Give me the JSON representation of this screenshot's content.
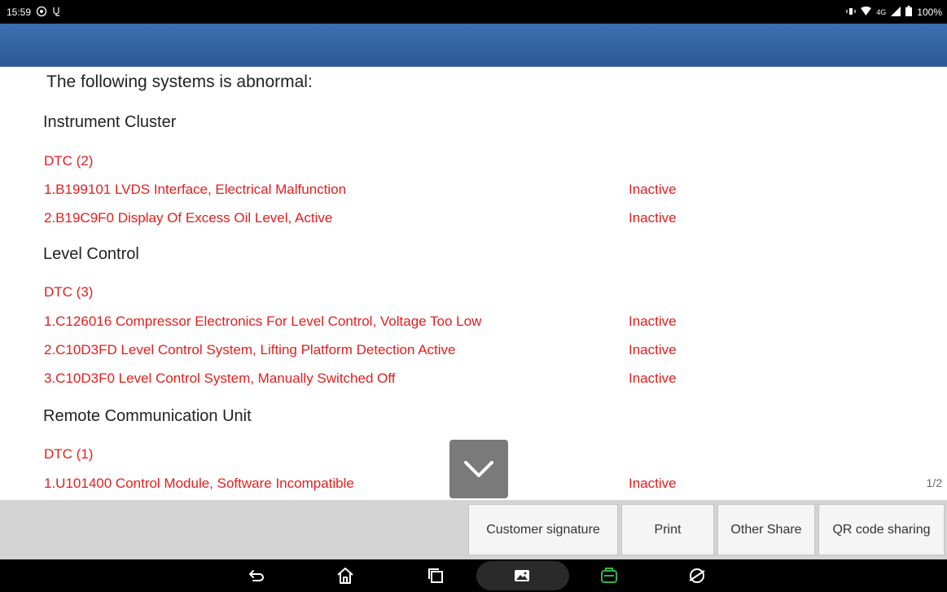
{
  "status_bar": {
    "time": "15:59",
    "network": "4G",
    "battery": "100%"
  },
  "report": {
    "intro": "The following systems is abnormal:",
    "sections": [
      {
        "title": "Instrument Cluster",
        "dtc_header": "DTC (2)",
        "codes": [
          {
            "text": "1.B199101 LVDS Interface, Electrical Malfunction",
            "status": "Inactive"
          },
          {
            "text": "2.B19C9F0 Display Of Excess Oil Level, Active",
            "status": "Inactive"
          }
        ]
      },
      {
        "title": "Level Control",
        "dtc_header": "DTC (3)",
        "codes": [
          {
            "text": "1.C126016 Compressor Electronics For Level Control, Voltage Too Low",
            "status": "Inactive"
          },
          {
            "text": "2.C10D3FD Level Control System, Lifting Platform Detection Active",
            "status": "Inactive"
          },
          {
            "text": "3.C10D3F0 Level Control System, Manually Switched Off",
            "status": "Inactive"
          }
        ]
      },
      {
        "title": "Remote Communication Unit",
        "dtc_header": "DTC (1)",
        "codes": [
          {
            "text": "1.U101400 Control Module, Software Incompatible",
            "status": "Inactive"
          }
        ]
      }
    ],
    "page_indicator": "1/2"
  },
  "actions": {
    "customer_signature": "Customer signature",
    "print": "Print",
    "other_share": "Other Share",
    "qr_code_sharing": "QR code sharing"
  },
  "colors": {
    "header_blue": "#2f5f9f",
    "dtc_red": "#e21e1e",
    "vci_green": "#2fb34a"
  }
}
